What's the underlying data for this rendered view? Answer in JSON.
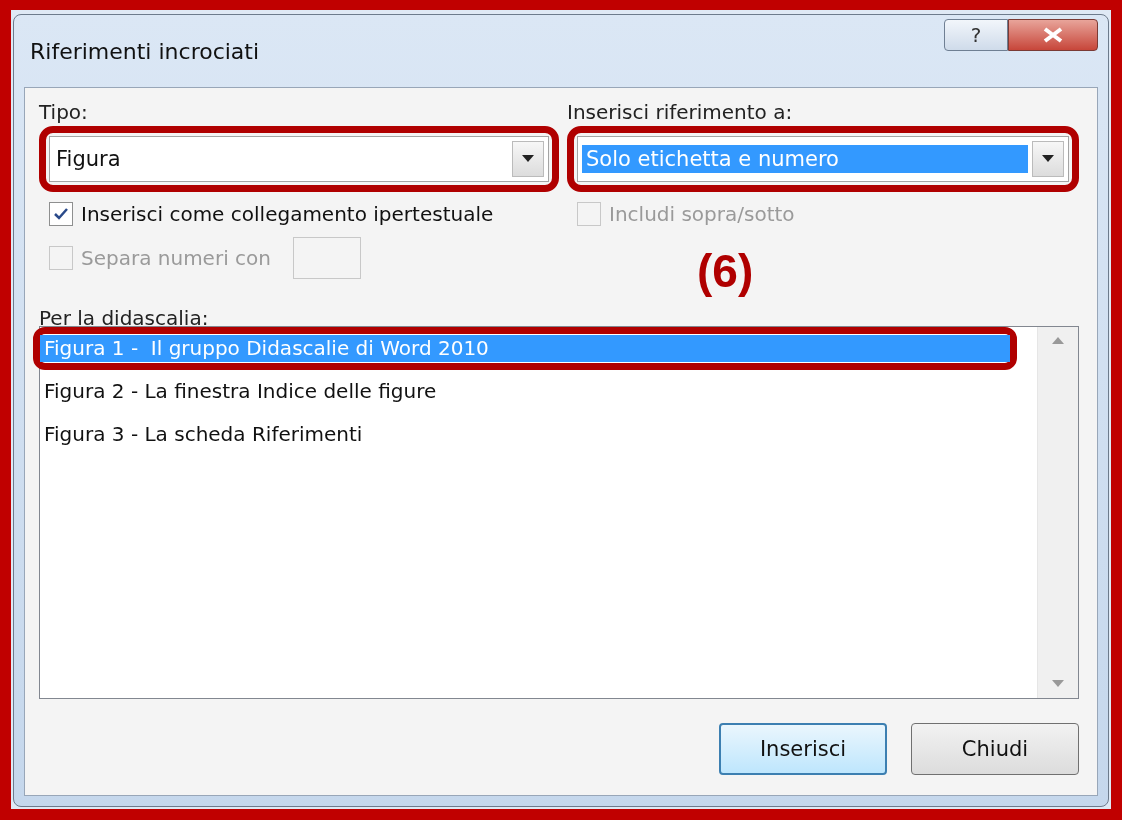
{
  "window": {
    "title": "Riferimenti incrociati",
    "help": "?"
  },
  "type": {
    "label": "Tipo:",
    "value": "Figura",
    "highlighted": true
  },
  "reference": {
    "label": "Inserisci riferimento a:",
    "value": "Solo etichetta e numero",
    "selected": true,
    "highlighted": true
  },
  "checkboxes": [
    {
      "label": "Inserisci come collegamento ipertestuale",
      "checked": true,
      "disabled": false
    },
    {
      "label": "Includi sopra/sotto",
      "checked": false,
      "disabled": true
    }
  ],
  "separate": {
    "label": "Separa numeri con",
    "checked": false,
    "disabled": true
  },
  "annotation": "(6)",
  "caption_list": {
    "label": "Per la didascalia:",
    "items": [
      {
        "text": "Figura 1 -  Il gruppo Didascalie di Word 2010",
        "selected": true,
        "highlighted": true
      },
      {
        "text": "Figura 2 - La finestra Indice delle figure",
        "selected": false,
        "highlighted": false
      },
      {
        "text": "Figura 3 - La scheda Riferimenti",
        "selected": false,
        "highlighted": false
      }
    ]
  },
  "buttons": [
    {
      "label": "Inserisci",
      "default": true
    },
    {
      "label": "Chiudi",
      "default": false
    }
  ]
}
